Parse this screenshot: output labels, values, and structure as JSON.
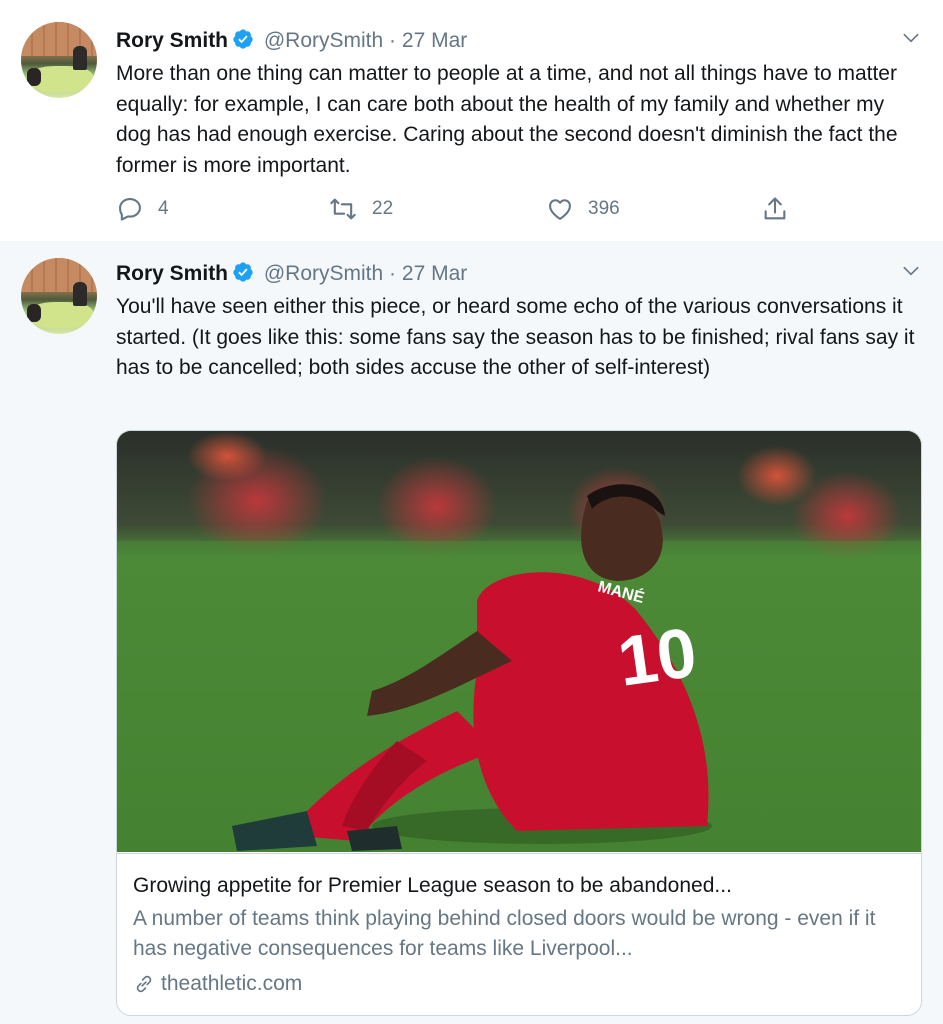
{
  "tweets": [
    {
      "name": "Rory Smith",
      "handle": "@RorySmith",
      "separator": "·",
      "date": "27 Mar",
      "text": "More than one thing can matter to people at a time, and not all things have to matter equally: for example, I can care both about the health of my family and whether my dog has had enough exercise. Caring about the second doesn't diminish the fact the former is more important.",
      "actions": {
        "reply_count": "4",
        "retweet_count": "22",
        "like_count": "396"
      }
    },
    {
      "name": "Rory Smith",
      "handle": "@RorySmith",
      "separator": "·",
      "date": "27 Mar",
      "text": "You'll have seen either this piece, or heard some echo of the various conversations it started. (It goes like this: some fans say the season has to be finished; rival fans say it has to be cancelled; both sides accuse the other of self-interest)",
      "card": {
        "image_icon": "footballer-photo",
        "jersey_name": "MANÉ",
        "jersey_number": "10",
        "title": "Growing appetite for Premier League season to be abandoned...",
        "description": "A number of teams think playing behind closed doors would be wrong - even if it has negative consequences for teams like Liverpool...",
        "domain": "theathletic.com"
      }
    }
  ],
  "colors": {
    "verified": "#1da1f2",
    "secondary_text": "#657786",
    "border": "#ccd6dd",
    "background": "#f5f8fa"
  }
}
